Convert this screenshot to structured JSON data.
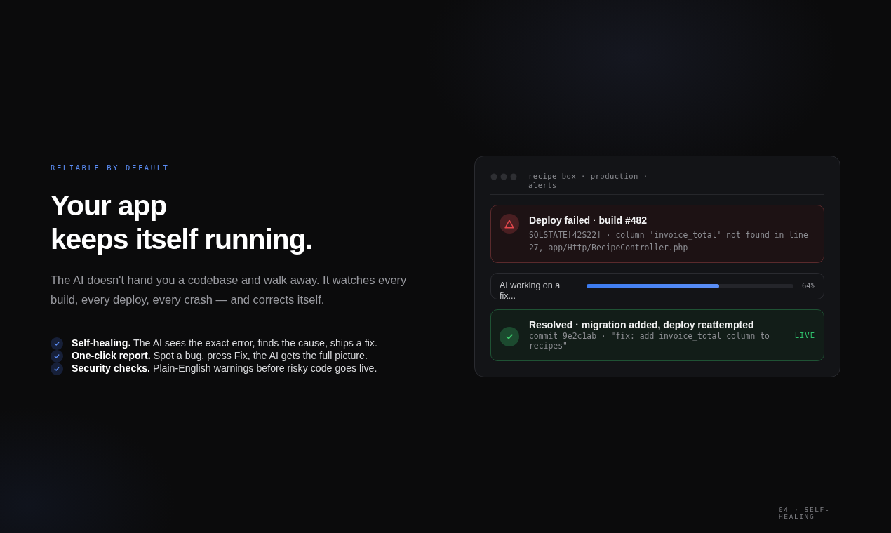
{
  "eyebrow": "RELIABLE BY DEFAULT",
  "title_lines": [
    "Your app",
    "keeps itself running."
  ],
  "intro": "The AI doesn't hand you a codebase and walk away. It watches every build, every deploy, every crash — and corrects itself.",
  "features": [
    {
      "text": "**Self-healing.** The AI sees the exact error, finds the cause, ships a fix.",
      "checked": true
    },
    {
      "text": "**One-click report.** Spot a bug, press Fix, the AI gets the full picture.",
      "checked": true
    },
    {
      "text": "**Security checks.** Plain-English warnings before risky code goes live.",
      "checked": true
    }
  ],
  "panel": {
    "title": "recipe-box · production · alerts",
    "alerts": [
      {
        "kind": "error",
        "title": "Deploy failed · build #482",
        "detail": "SQLSTATE[42S22] · column 'invoice_total' not found in line 27, app/Http/RecipeController.php"
      },
      {
        "kind": "progress",
        "label": "AI working on a fix...",
        "level": 0.64,
        "reading": "64%"
      },
      {
        "kind": "success",
        "title": "Resolved · migration added, deploy reattempted",
        "detail": "commit 9e2c1ab · \"fix: add invoice_total column to recipes\"",
        "badge": "LIVE"
      }
    ]
  },
  "footer": "04 · SELF-HEALING"
}
